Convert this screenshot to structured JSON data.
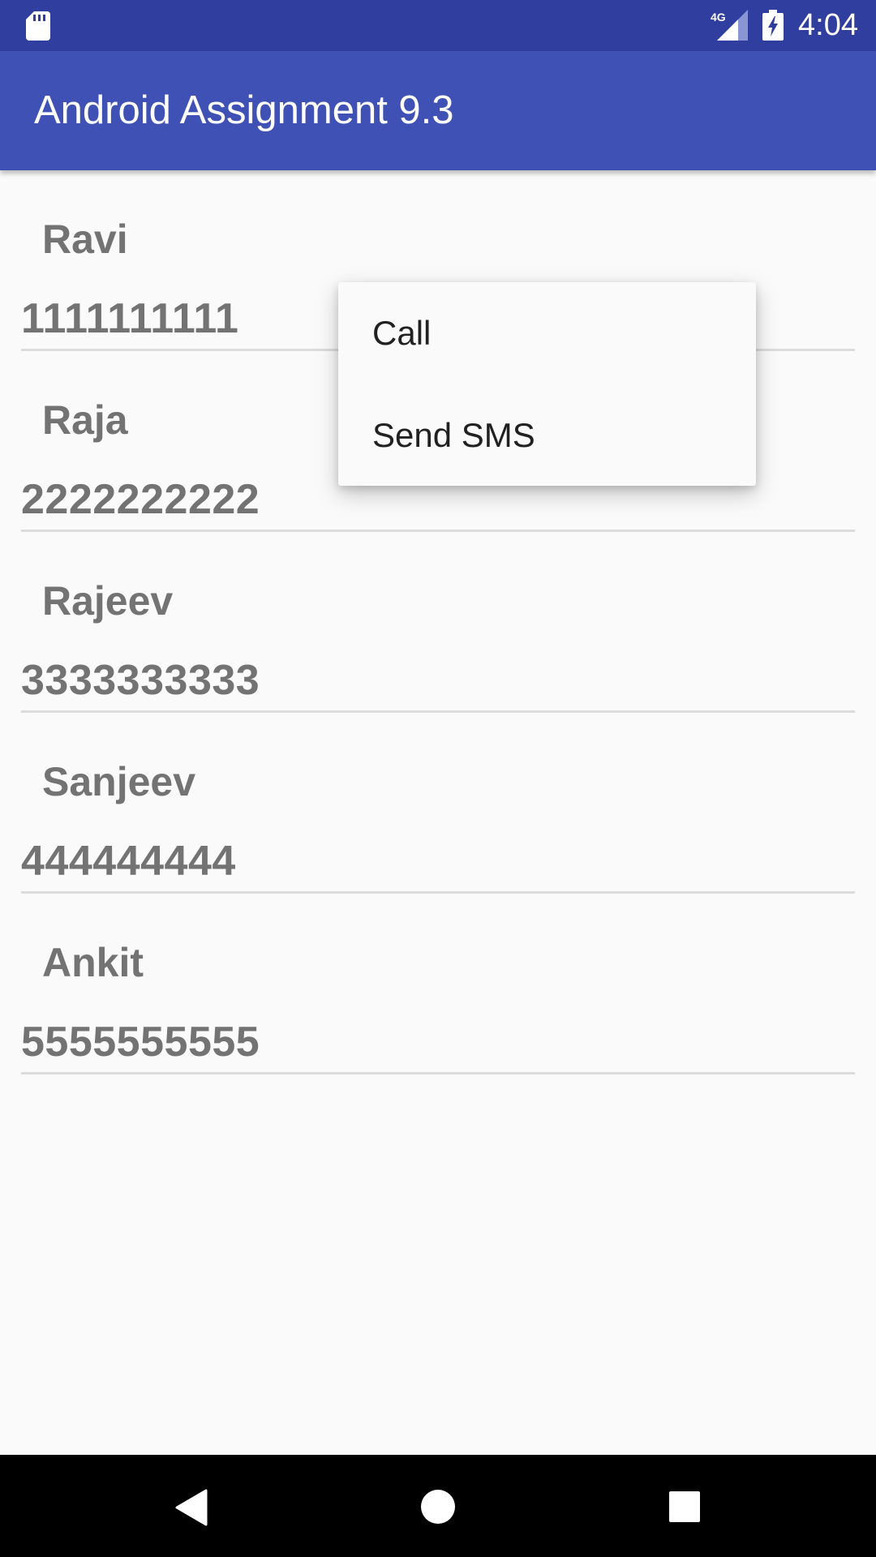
{
  "status_bar": {
    "time": "4:04",
    "network_label": "4G",
    "icons": [
      "sd-card-icon",
      "cellular-signal-icon",
      "battery-charging-icon"
    ]
  },
  "app_bar": {
    "title": "Android Assignment 9.3"
  },
  "contacts": [
    {
      "name": "Ravi",
      "phone": "1111111111"
    },
    {
      "name": "Raja",
      "phone": "2222222222"
    },
    {
      "name": "Rajeev",
      "phone": "3333333333"
    },
    {
      "name": "Sanjeev",
      "phone": "444444444"
    },
    {
      "name": "Ankit",
      "phone": "5555555555"
    }
  ],
  "context_menu": {
    "items": [
      {
        "label": "Call"
      },
      {
        "label": "Send SMS"
      }
    ]
  },
  "nav_bar": {
    "icons": [
      "back-icon",
      "home-icon",
      "recents-icon"
    ]
  },
  "colors": {
    "status_bar": "#303f9f",
    "app_bar": "#3f51b5",
    "list_text": "#737373",
    "background": "#fafafa"
  }
}
